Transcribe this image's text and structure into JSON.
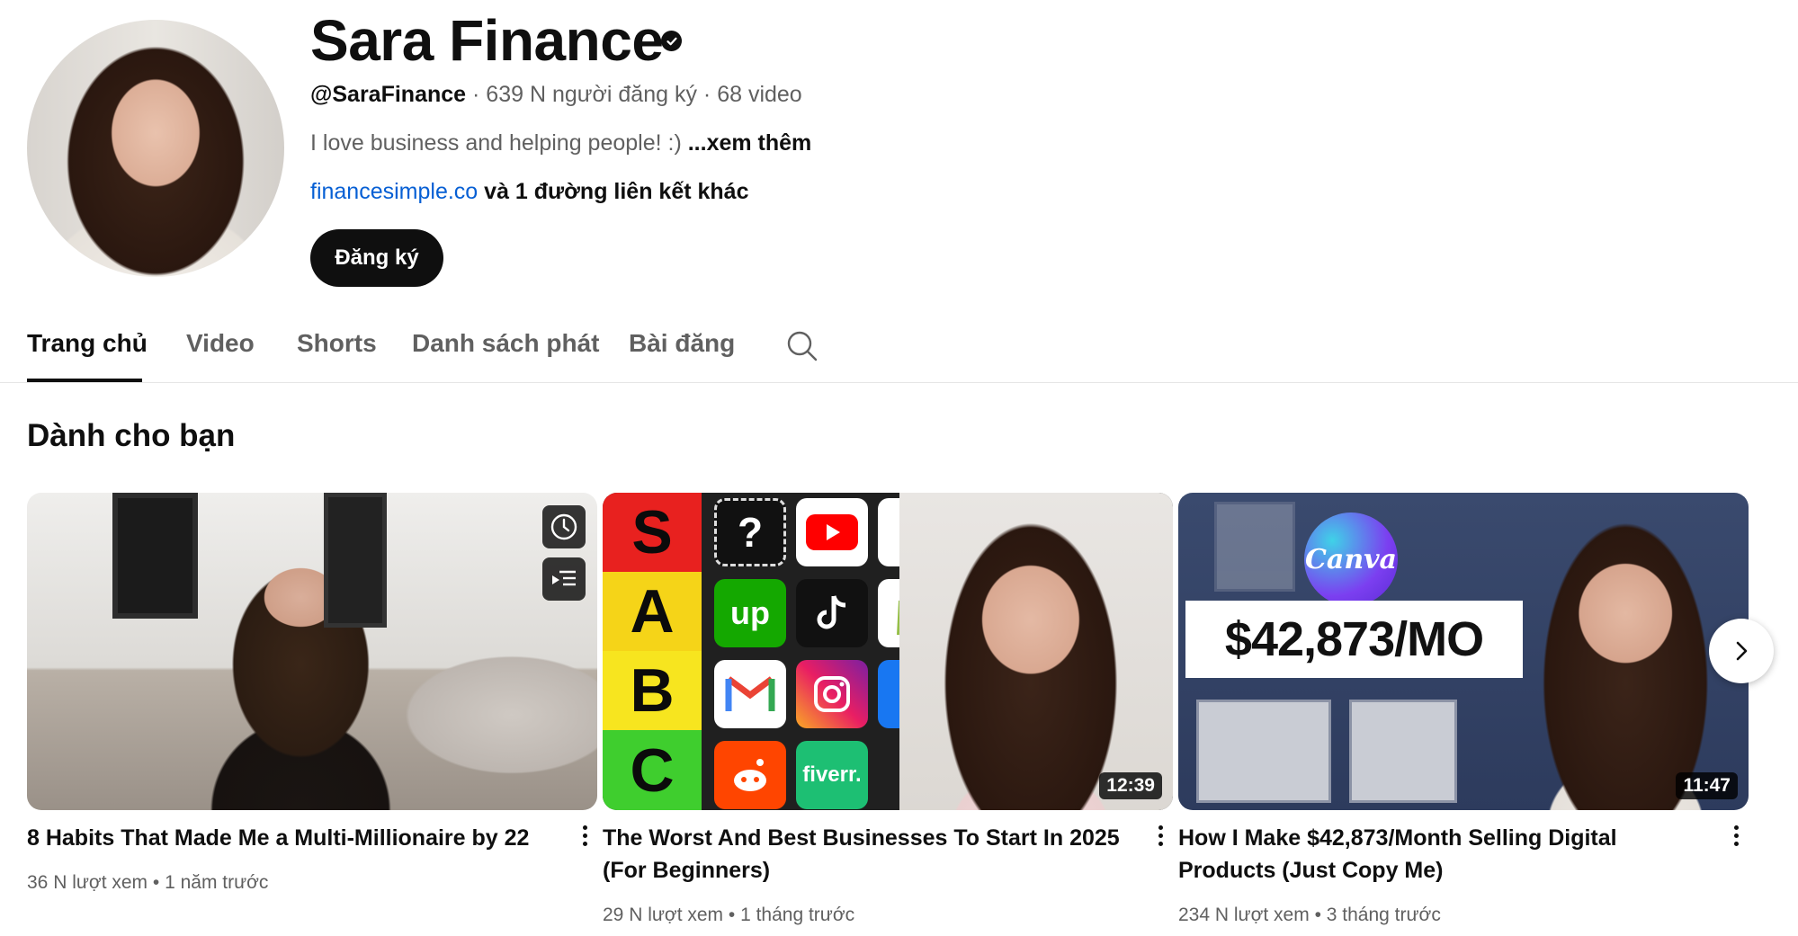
{
  "channel": {
    "title": "Sara Finance",
    "handle": "@SaraFinance",
    "subscribers": "639 N người đăng ký",
    "video_count": "68 video",
    "separator": "·",
    "description": "I love business and helping people! :)",
    "more_label": "...xem thêm",
    "link": "financesimple.co",
    "other_links": "và 1 đường liên kết khác",
    "subscribe_label": "Đăng ký"
  },
  "tabs": [
    {
      "label": "Trang chủ",
      "active": true
    },
    {
      "label": "Video",
      "active": false
    },
    {
      "label": "Shorts",
      "active": false
    },
    {
      "label": "Danh sách phát",
      "active": false
    },
    {
      "label": "Bài đăng",
      "active": false
    }
  ],
  "section": {
    "title": "Dành cho bạn"
  },
  "videos": [
    {
      "title": "8 Habits That Made Me a Multi-Millionaire by 22",
      "views": "36 N lượt xem",
      "age": "1 năm trước",
      "duration": ""
    },
    {
      "title": "The Worst And Best Businesses To Start In 2025 (For Beginners)",
      "views": "29 N lượt xem",
      "age": "1 tháng trước",
      "duration": "12:39",
      "thumb_text": {
        "tiers": [
          "S",
          "A",
          "B",
          "C"
        ],
        "tiles": [
          "?",
          "up",
          "fiverr."
        ]
      }
    },
    {
      "title": "How I Make $42,873/Month Selling Digital Products (Just Copy Me)",
      "views": "234 N lượt xem",
      "age": "3 tháng trước",
      "duration": "11:47",
      "thumb_text": {
        "logo": "Canva",
        "headline": "$42,873/MO"
      }
    }
  ],
  "meta_separator": "•",
  "icons": {
    "verified": "verified-check-icon",
    "search": "search-icon",
    "watch_later": "clock-icon",
    "add_to_queue": "queue-icon",
    "more": "kebab-menu-icon",
    "next": "chevron-right-icon"
  },
  "colors": {
    "link": "#065fd4",
    "text": "#0f0f0f",
    "secondary_text": "#606060",
    "subscribe_bg": "#0f0f0f",
    "tier_S": "#e8211f",
    "tier_A": "#f5d418",
    "tier_B": "#f7e51f",
    "tier_C": "#3fce2e"
  }
}
